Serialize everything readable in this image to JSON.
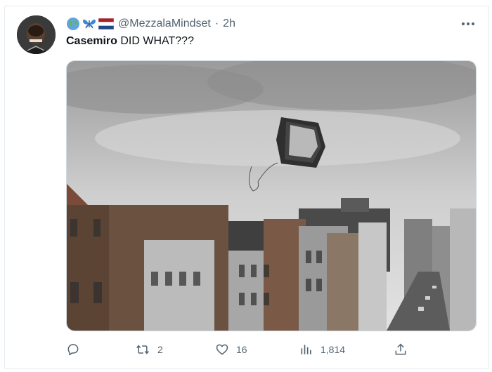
{
  "tweet": {
    "flags": [
      "globe-flag-emoji",
      "butterfly-emoji",
      "netherlands-flag-emoji"
    ],
    "handle": "@MezzalaMindset",
    "separator": "·",
    "time": "2h",
    "text_bold": "Casemiro",
    "text_rest": " DID WHAT???",
    "image_alt": "Old CRT television flying through the air above a city street lined with buildings"
  },
  "actions": {
    "reply_count": "",
    "retweet_count": "2",
    "like_count": "16",
    "views_count": "1,814"
  },
  "colors": {
    "text_primary": "#0f1419",
    "text_secondary": "#536471",
    "border": "#cfd9de"
  }
}
